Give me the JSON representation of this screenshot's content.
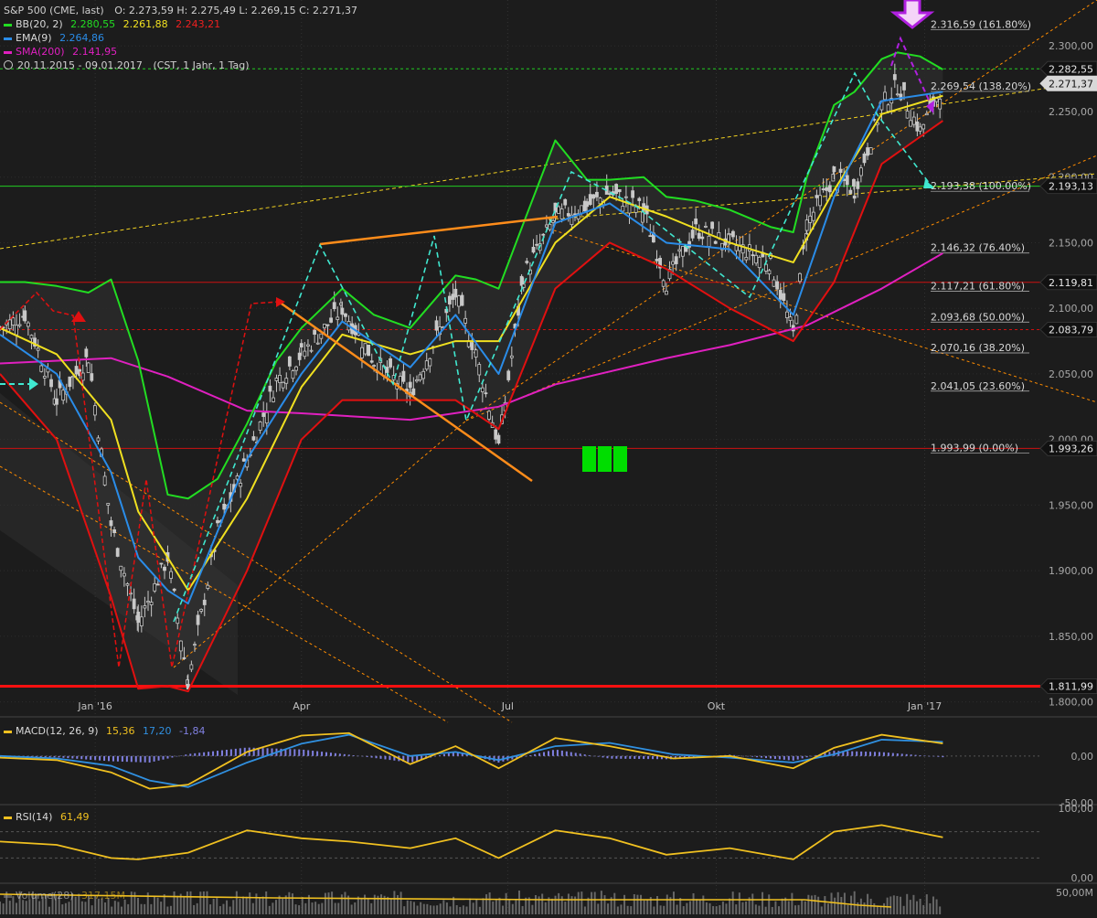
{
  "header": {
    "instrument": "S&P 500 (CME, last)",
    "ohlc": "O: 2.273,59  H: 2.275,49  L: 2.269,15  C: 2.271,37",
    "bb_label": "BB(20, 2)",
    "bb_vals": [
      "2.280,55",
      "2.261,88",
      "2.243,21"
    ],
    "ema_label": "EMA(9)",
    "ema_val": "2.264,86",
    "sma_label": "SMA(200)",
    "sma_val": "2.141,95",
    "range": "20.11.2015 - 09.01.2017",
    "range_info": "(CST, 1 Jahr, 1 Tag)"
  },
  "colors": {
    "background": "#1c1c1c",
    "candle": "#c8c8c8",
    "bb_band": "#2a2a2a",
    "bb_upper": "#22dd22",
    "bb_middle": "#f0e020",
    "bb_lower": "#e01010",
    "ema": "#2a8ce8",
    "sma": "#e020c0",
    "fib": "#ff8c00",
    "level_red": "#cc1010",
    "level_green": "#22cc22",
    "trend_orange": "#ff8c1a",
    "cyan": "#40e8d0",
    "purple": "#b020e0",
    "macd": "#f0c020",
    "signal": "#3090e0",
    "histogram": "#8080e0",
    "rsi": "#f0c020",
    "volume_bar": "#888888",
    "green_blocks": "#00dd00"
  },
  "chart_data": [
    {
      "type": "line",
      "title": "S&P 500 (CME, last)",
      "subtitle": "20.11.2015 - 09.01.2017 (CST, 1 Jahr, 1 Tag)",
      "ylim": [
        1790,
        2335
      ],
      "y_ticks": [
        1800,
        1850,
        1900,
        1950,
        2000,
        2050,
        2100,
        2150,
        2200,
        2250,
        2300
      ],
      "y_tick_labels": [
        "1.800,00",
        "1.850,00",
        "1.900,00",
        "1.950,00",
        "2.000,00",
        "2.050,00",
        "2.100,00",
        "2.150,00",
        "2.200,00",
        "2.250,00",
        "2.300,00"
      ],
      "x_tick_labels": [
        "Jan '16",
        "Apr",
        "Jul",
        "Okt",
        "Jan '17"
      ],
      "x_tick_dates": [
        "2016-01-01",
        "2016-04-01",
        "2016-07-01",
        "2016-10-01",
        "2017-01-01"
      ],
      "x_range": [
        "2015-11-20",
        "2017-02-21"
      ],
      "fib_levels": [
        {
          "label": "2.316,59 (161.80%)",
          "value": 2316.59
        },
        {
          "label": "2.269,54 (138.20%)",
          "value": 2269.54
        },
        {
          "label": "2.193,38 (100.00%)",
          "value": 2193.38
        },
        {
          "label": "2.146,32 (76.40%)",
          "value": 2146.32
        },
        {
          "label": "2.117,21 (61.80%)",
          "value": 2117.21
        },
        {
          "label": "2.093,68 (50.00%)",
          "value": 2093.68
        },
        {
          "label": "2.070,16 (38.20%)",
          "value": 2070.16
        },
        {
          "label": "2.041,05 (23.60%)",
          "value": 2041.05
        },
        {
          "label": "1.993,99 (0.00%)",
          "value": 1993.99
        }
      ],
      "price_boxes": [
        {
          "label": "2.282,55",
          "value": 2282.55,
          "style": "dark"
        },
        {
          "label": "2.271,37",
          "value": 2271.37,
          "style": "light"
        },
        {
          "label": "2.193,13",
          "value": 2193.13,
          "style": "dark"
        },
        {
          "label": "2.119,81",
          "value": 2119.81,
          "style": "dark"
        },
        {
          "label": "2.083,79",
          "value": 2083.79,
          "style": "dark"
        },
        {
          "label": "1.993,26",
          "value": 1993.26,
          "style": "dark"
        },
        {
          "label": "1.811,99",
          "value": 1811.99,
          "style": "dark"
        }
      ],
      "horizontal_lines": [
        {
          "value": 2282.55,
          "color": "#22cc22",
          "dash": true
        },
        {
          "value": 2193.13,
          "color": "#22cc22",
          "dash": false
        },
        {
          "value": 2119.81,
          "color": "#cc1010",
          "dash": false
        },
        {
          "value": 2083.79,
          "color": "#cc1010",
          "dash": true
        },
        {
          "value": 1993.26,
          "color": "#cc1010",
          "dash": false
        },
        {
          "value": 1811.99,
          "color": "#ff1010",
          "dash": false,
          "thick": true
        }
      ],
      "series": [
        {
          "name": "S&P 500",
          "x": [
            "2015-11-20",
            "2015-12-01",
            "2015-12-15",
            "2015-12-29",
            "2016-01-08",
            "2016-01-20",
            "2016-02-02",
            "2016-02-11",
            "2016-02-24",
            "2016-03-08",
            "2016-03-21",
            "2016-04-01",
            "2016-04-19",
            "2016-05-03",
            "2016-05-19",
            "2016-06-08",
            "2016-06-17",
            "2016-06-27",
            "2016-07-08",
            "2016-07-22",
            "2016-08-05",
            "2016-08-15",
            "2016-08-30",
            "2016-09-09",
            "2016-09-22",
            "2016-10-07",
            "2016-10-25",
            "2016-11-04",
            "2016-11-10",
            "2016-11-22",
            "2016-12-01",
            "2016-12-13",
            "2016-12-20",
            "2016-12-30",
            "2017-01-09"
          ],
          "values": [
            2085,
            2095,
            2030,
            2063,
            1935,
            1860,
            1910,
            1815,
            1930,
            1985,
            2045,
            2065,
            2100,
            2060,
            2035,
            2110,
            2065,
            1995,
            2125,
            2170,
            2178,
            2188,
            2175,
            2120,
            2160,
            2150,
            2135,
            2080,
            2165,
            2200,
            2190,
            2255,
            2270,
            2235,
            2271
          ]
        },
        {
          "name": "BB upper",
          "x": [
            "2015-11-20",
            "2015-12-01",
            "2015-12-15",
            "2015-12-29",
            "2016-01-08",
            "2016-01-20",
            "2016-02-02",
            "2016-02-11",
            "2016-02-24",
            "2016-03-08",
            "2016-03-21",
            "2016-04-01",
            "2016-04-19",
            "2016-05-03",
            "2016-05-19",
            "2016-06-08",
            "2016-06-17",
            "2016-06-27",
            "2016-07-08",
            "2016-07-22",
            "2016-08-05",
            "2016-08-15",
            "2016-08-30",
            "2016-09-09",
            "2016-09-22",
            "2016-10-07",
            "2016-10-25",
            "2016-11-04",
            "2016-11-10",
            "2016-11-22",
            "2016-12-01",
            "2016-12-13",
            "2016-12-20",
            "2016-12-30",
            "2017-01-09"
          ],
          "values": [
            2120,
            2120,
            2117,
            2112,
            2122,
            2060,
            1958,
            1955,
            1970,
            2012,
            2060,
            2085,
            2115,
            2095,
            2085,
            2125,
            2122,
            2115,
            2165,
            2228,
            2198,
            2198,
            2200,
            2185,
            2182,
            2175,
            2162,
            2158,
            2200,
            2255,
            2265,
            2290,
            2295,
            2292,
            2282
          ]
        },
        {
          "name": "BB middle",
          "x": [
            "2015-11-20",
            "2015-12-15",
            "2016-01-08",
            "2016-01-20",
            "2016-02-02",
            "2016-02-11",
            "2016-03-08",
            "2016-04-01",
            "2016-04-19",
            "2016-05-19",
            "2016-06-08",
            "2016-06-27",
            "2016-07-22",
            "2016-08-15",
            "2016-09-09",
            "2016-10-07",
            "2016-11-04",
            "2016-11-22",
            "2016-12-13",
            "2017-01-09"
          ],
          "values": [
            2085,
            2065,
            2015,
            1945,
            1910,
            1885,
            1955,
            2040,
            2080,
            2065,
            2075,
            2075,
            2150,
            2185,
            2170,
            2150,
            2135,
            2190,
            2248,
            2262
          ]
        },
        {
          "name": "BB lower",
          "x": [
            "2015-11-20",
            "2015-12-15",
            "2016-01-08",
            "2016-01-20",
            "2016-02-02",
            "2016-02-11",
            "2016-03-08",
            "2016-04-01",
            "2016-04-19",
            "2016-05-19",
            "2016-06-08",
            "2016-06-27",
            "2016-07-22",
            "2016-08-15",
            "2016-09-09",
            "2016-10-07",
            "2016-11-04",
            "2016-11-22",
            "2016-12-13",
            "2017-01-09"
          ],
          "values": [
            2050,
            2000,
            1880,
            1810,
            1812,
            1808,
            1900,
            2000,
            2030,
            2030,
            2030,
            2008,
            2115,
            2150,
            2130,
            2100,
            2075,
            2120,
            2210,
            2243
          ]
        },
        {
          "name": "EMA(9)",
          "x": [
            "2015-11-20",
            "2015-12-15",
            "2016-01-08",
            "2016-01-20",
            "2016-02-02",
            "2016-02-11",
            "2016-03-08",
            "2016-04-01",
            "2016-04-19",
            "2016-05-19",
            "2016-06-08",
            "2016-06-27",
            "2016-07-22",
            "2016-08-15",
            "2016-09-09",
            "2016-10-07",
            "2016-11-04",
            "2016-11-22",
            "2016-12-13",
            "2017-01-09"
          ],
          "values": [
            2080,
            2050,
            1975,
            1910,
            1885,
            1875,
            1985,
            2050,
            2090,
            2055,
            2095,
            2050,
            2165,
            2180,
            2150,
            2145,
            2095,
            2185,
            2258,
            2265
          ]
        },
        {
          "name": "SMA(200)",
          "x": [
            "2015-11-20",
            "2016-01-08",
            "2016-02-02",
            "2016-03-08",
            "2016-04-01",
            "2016-05-19",
            "2016-06-27",
            "2016-07-22",
            "2016-09-09",
            "2016-10-07",
            "2016-11-10",
            "2016-12-13",
            "2017-01-09"
          ],
          "values": [
            2058,
            2062,
            2048,
            2022,
            2020,
            2015,
            2025,
            2042,
            2062,
            2072,
            2087,
            2115,
            2142
          ]
        }
      ],
      "legend": [
        "BB(20, 2)",
        "EMA(9)",
        "SMA(200)"
      ],
      "annotations": [
        "green blocks pattern",
        "orange trend lines",
        "cyan dashed projection",
        "purple projected arrows"
      ]
    },
    {
      "type": "line",
      "title": "MACD(12, 26, 9)",
      "legend_values": [
        "15,36",
        "17,20",
        "-1,84"
      ],
      "y_tick_labels": [
        "0,00",
        "-50,00"
      ],
      "ylim": [
        -55,
        30
      ],
      "series": [
        {
          "name": "MACD",
          "x": [
            "2015-11-20",
            "2015-12-15",
            "2016-01-08",
            "2016-01-25",
            "2016-02-11",
            "2016-03-08",
            "2016-04-01",
            "2016-04-22",
            "2016-05-19",
            "2016-06-08",
            "2016-06-27",
            "2016-07-22",
            "2016-08-15",
            "2016-09-12",
            "2016-10-07",
            "2016-11-04",
            "2016-11-22",
            "2016-12-13",
            "2017-01-09"
          ],
          "values": [
            -2,
            -5,
            -20,
            -40,
            -35,
            5,
            25,
            28,
            -10,
            12,
            -15,
            22,
            12,
            -3,
            0,
            -15,
            10,
            26,
            15.36
          ]
        },
        {
          "name": "Signal",
          "x": [
            "2015-11-20",
            "2015-12-15",
            "2016-01-08",
            "2016-01-25",
            "2016-02-11",
            "2016-03-08",
            "2016-04-01",
            "2016-04-22",
            "2016-05-19",
            "2016-06-08",
            "2016-06-27",
            "2016-07-22",
            "2016-08-15",
            "2016-09-12",
            "2016-10-07",
            "2016-11-04",
            "2016-11-22",
            "2016-12-13",
            "2017-01-09"
          ],
          "values": [
            0,
            -3,
            -12,
            -30,
            -38,
            -8,
            15,
            26,
            0,
            5,
            -5,
            12,
            16,
            2,
            -2,
            -8,
            2,
            20,
            17.2
          ]
        }
      ]
    },
    {
      "type": "line",
      "title": "RSI(14)",
      "legend_values": [
        "61,49"
      ],
      "y_tick_labels": [
        "100,00",
        "0,00"
      ],
      "ylim": [
        0,
        100
      ],
      "series": [
        {
          "name": "RSI",
          "x": [
            "2015-11-20",
            "2015-12-15",
            "2016-01-08",
            "2016-01-20",
            "2016-02-11",
            "2016-03-08",
            "2016-04-01",
            "2016-04-22",
            "2016-05-19",
            "2016-06-08",
            "2016-06-27",
            "2016-07-22",
            "2016-08-15",
            "2016-09-09",
            "2016-10-07",
            "2016-11-04",
            "2016-11-22",
            "2016-12-13",
            "2017-01-09"
          ],
          "values": [
            55,
            50,
            30,
            28,
            38,
            72,
            60,
            55,
            45,
            60,
            30,
            72,
            60,
            35,
            45,
            28,
            70,
            80,
            61.49
          ]
        }
      ]
    },
    {
      "type": "bar",
      "title": "Volume(28)",
      "legend_values": [
        "317,15M"
      ],
      "y_tick_labels": [
        "50,00M"
      ]
    }
  ]
}
